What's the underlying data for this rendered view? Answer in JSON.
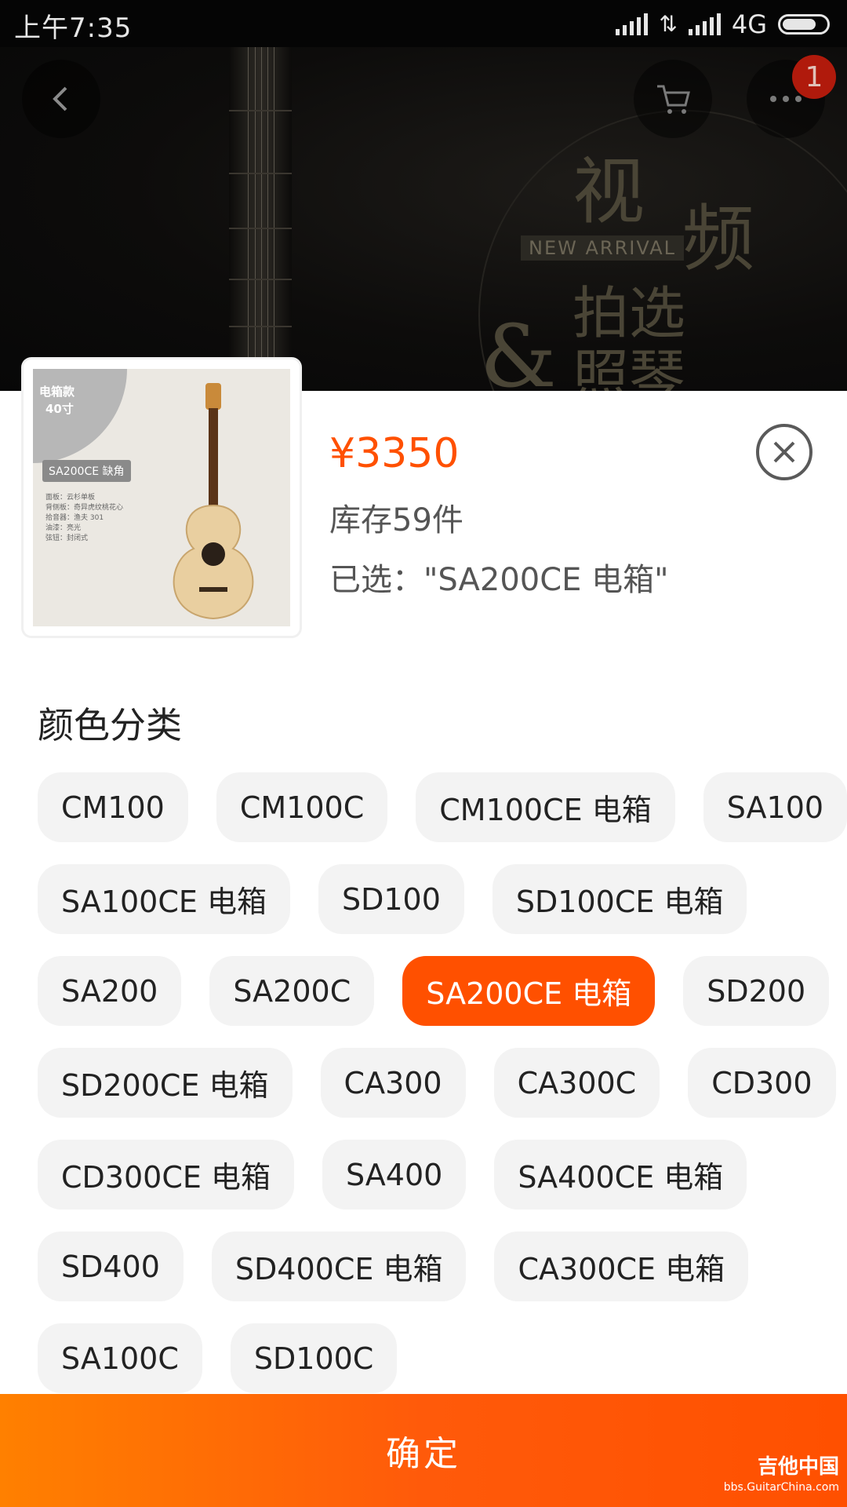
{
  "status_bar": {
    "time": "上午7:35",
    "network": "4G"
  },
  "header": {
    "cart_badge": "1"
  },
  "hero": {
    "text1": "视",
    "text2": "频",
    "text3": "拍选",
    "text4": "照琴",
    "amp": "&",
    "new_arrival": "NEW ARRIVAL"
  },
  "thumbnail": {
    "corner_line1": "电箱款",
    "corner_line2": "40寸",
    "tag": "SA200CE 缺角",
    "spec1": "面板：云杉单板",
    "spec2": "背侧板：奇异虎纹桃花心",
    "spec3": "拾音器：渔夫 301",
    "spec4": "油漆：亮光",
    "spec5": "弦钮：封闭式"
  },
  "product": {
    "price": "¥3350",
    "stock": "库存59件",
    "selected": "已选：\"SA200CE 电箱\""
  },
  "section_title": "颜色分类",
  "options": [
    [
      "CM100",
      "CM100C",
      "CM100CE 电箱",
      "SA100"
    ],
    [
      "SA100CE 电箱",
      "SD100",
      "SD100CE 电箱"
    ],
    [
      "SA200",
      "SA200C",
      "SA200CE 电箱",
      "SD200"
    ],
    [
      "SD200CE 电箱",
      "CA300",
      "CA300C",
      "CD300"
    ],
    [
      "CD300CE 电箱",
      "SA400",
      "SA400CE 电箱"
    ],
    [
      "SD400",
      "SD400CE 电箱",
      "CA300CE 电箱"
    ],
    [
      "SA100C",
      "SD100C"
    ]
  ],
  "selected_option": "SA200CE 电箱",
  "confirm_label": "确定",
  "watermark": {
    "line1": "吉他中国",
    "line2": "bbs.GuitarChina.com"
  },
  "colors": {
    "accent": "#ff5000",
    "chip_bg": "#f3f3f3"
  }
}
